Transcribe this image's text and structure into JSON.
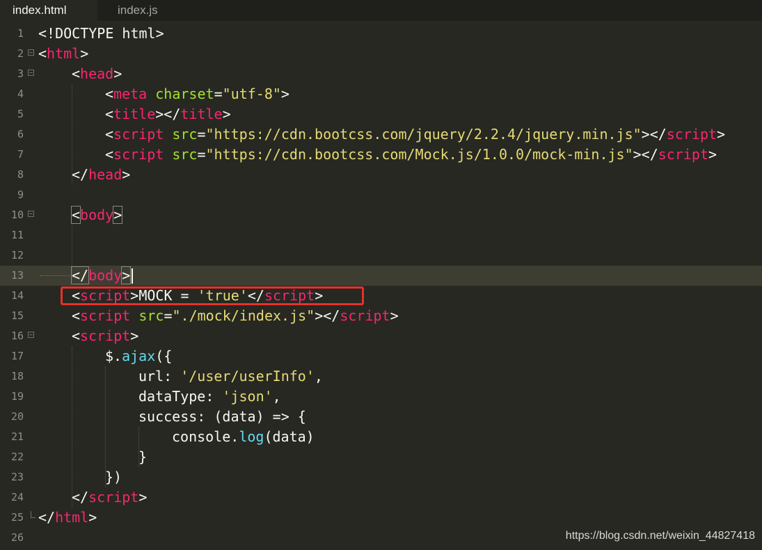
{
  "tabs": [
    {
      "label": "index.html",
      "active": true
    },
    {
      "label": "index.js",
      "active": false
    }
  ],
  "colors": {
    "background": "#272822",
    "tag": "#f92672",
    "attribute": "#a6e22e",
    "string": "#e6db74",
    "function": "#66d9ef",
    "text": "#f8f8f2",
    "annotation": "#e8302a"
  },
  "editor": {
    "current_line": 13,
    "annotated_line": 14,
    "lines": [
      {
        "n": "1",
        "indent": 0,
        "fold": "",
        "tokens": [
          [
            "p",
            "<!DOCTYPE html>"
          ]
        ]
      },
      {
        "n": "2",
        "indent": 0,
        "fold": "open",
        "tokens": [
          [
            "p",
            "<"
          ],
          [
            "tag",
            "html"
          ],
          [
            "p",
            ">"
          ]
        ]
      },
      {
        "n": "3",
        "indent": 1,
        "fold": "open",
        "tokens": [
          [
            "p",
            "<"
          ],
          [
            "tag",
            "head"
          ],
          [
            "p",
            ">"
          ]
        ]
      },
      {
        "n": "4",
        "indent": 2,
        "fold": "",
        "tokens": [
          [
            "p",
            "<"
          ],
          [
            "tag",
            "meta"
          ],
          [
            "p",
            " "
          ],
          [
            "attr",
            "charset"
          ],
          [
            "p",
            "="
          ],
          [
            "str",
            "\"utf-8\""
          ],
          [
            "p",
            ">"
          ]
        ]
      },
      {
        "n": "5",
        "indent": 2,
        "fold": "",
        "tokens": [
          [
            "p",
            "<"
          ],
          [
            "tag",
            "title"
          ],
          [
            "p",
            "></"
          ],
          [
            "tag",
            "title"
          ],
          [
            "p",
            ">"
          ]
        ]
      },
      {
        "n": "6",
        "indent": 2,
        "fold": "",
        "tokens": [
          [
            "p",
            "<"
          ],
          [
            "tag",
            "script"
          ],
          [
            "p",
            " "
          ],
          [
            "attr",
            "src"
          ],
          [
            "p",
            "="
          ],
          [
            "str",
            "\"https://cdn.bootcss.com/jquery/2.2.4/jquery.min.js\""
          ],
          [
            "p",
            "></"
          ],
          [
            "tag",
            "script"
          ],
          [
            "p",
            ">"
          ]
        ]
      },
      {
        "n": "7",
        "indent": 2,
        "fold": "",
        "tokens": [
          [
            "p",
            "<"
          ],
          [
            "tag",
            "script"
          ],
          [
            "p",
            " "
          ],
          [
            "attr",
            "src"
          ],
          [
            "p",
            "="
          ],
          [
            "str",
            "\"https://cdn.bootcss.com/Mock.js/1.0.0/mock-min.js\""
          ],
          [
            "p",
            "></"
          ],
          [
            "tag",
            "script"
          ],
          [
            "p",
            ">"
          ]
        ]
      },
      {
        "n": "8",
        "indent": 1,
        "fold": "",
        "tokens": [
          [
            "p",
            "</"
          ],
          [
            "tag",
            "head"
          ],
          [
            "p",
            ">"
          ]
        ]
      },
      {
        "n": "9",
        "indent": 0,
        "fold": "",
        "tokens": []
      },
      {
        "n": "10",
        "indent": 1,
        "fold": "open",
        "tokens": [
          [
            "box",
            "<"
          ],
          [
            "tag",
            "body"
          ],
          [
            "box",
            ">"
          ]
        ]
      },
      {
        "n": "11",
        "indent": 0,
        "fold": "",
        "tokens": []
      },
      {
        "n": "12",
        "indent": 0,
        "fold": "",
        "tokens": []
      },
      {
        "n": "13",
        "indent": 1,
        "fold": "",
        "tokens": [
          [
            "box",
            "</"
          ],
          [
            "tag",
            "body"
          ],
          [
            "box",
            ">"
          ]
        ]
      },
      {
        "n": "14",
        "indent": 1,
        "fold": "",
        "tokens": [
          [
            "p",
            "<"
          ],
          [
            "tag",
            "script"
          ],
          [
            "p",
            ">MOCK = "
          ],
          [
            "str",
            "'true'"
          ],
          [
            "p",
            "</"
          ],
          [
            "tag",
            "script"
          ],
          [
            "p",
            ">"
          ]
        ]
      },
      {
        "n": "15",
        "indent": 1,
        "fold": "",
        "tokens": [
          [
            "p",
            "<"
          ],
          [
            "tag",
            "script"
          ],
          [
            "p",
            " "
          ],
          [
            "attr",
            "src"
          ],
          [
            "p",
            "="
          ],
          [
            "str",
            "\"./mock/index.js\""
          ],
          [
            "p",
            "></"
          ],
          [
            "tag",
            "script"
          ],
          [
            "p",
            ">"
          ]
        ]
      },
      {
        "n": "16",
        "indent": 1,
        "fold": "open",
        "tokens": [
          [
            "p",
            "<"
          ],
          [
            "tag",
            "script"
          ],
          [
            "p",
            ">"
          ]
        ]
      },
      {
        "n": "17",
        "indent": 2,
        "fold": "",
        "tokens": [
          [
            "p",
            "$."
          ],
          [
            "fn",
            "ajax"
          ],
          [
            "p",
            "({"
          ]
        ]
      },
      {
        "n": "18",
        "indent": 3,
        "fold": "",
        "tokens": [
          [
            "p",
            "url: "
          ],
          [
            "str",
            "'/user/userInfo'"
          ],
          [
            "p",
            ","
          ]
        ]
      },
      {
        "n": "19",
        "indent": 3,
        "fold": "",
        "tokens": [
          [
            "p",
            "dataType: "
          ],
          [
            "str",
            "'json'"
          ],
          [
            "p",
            ","
          ]
        ]
      },
      {
        "n": "20",
        "indent": 3,
        "fold": "",
        "tokens": [
          [
            "p",
            "success: (data) => {"
          ]
        ]
      },
      {
        "n": "21",
        "indent": 4,
        "fold": "",
        "tokens": [
          [
            "p",
            "console."
          ],
          [
            "fn",
            "log"
          ],
          [
            "p",
            "(data)"
          ]
        ]
      },
      {
        "n": "22",
        "indent": 3,
        "fold": "",
        "tokens": [
          [
            "p",
            "}"
          ]
        ]
      },
      {
        "n": "23",
        "indent": 2,
        "fold": "",
        "tokens": [
          [
            "p",
            "})"
          ]
        ]
      },
      {
        "n": "24",
        "indent": 1,
        "fold": "",
        "tokens": [
          [
            "p",
            "</"
          ],
          [
            "tag",
            "script"
          ],
          [
            "p",
            ">"
          ]
        ]
      },
      {
        "n": "25",
        "indent": 0,
        "fold": "end",
        "tokens": [
          [
            "p",
            "</"
          ],
          [
            "tag",
            "html"
          ],
          [
            "p",
            ">"
          ]
        ]
      },
      {
        "n": "26",
        "indent": 0,
        "fold": "",
        "tokens": []
      }
    ]
  },
  "watermark": "https://blog.csdn.net/weixin_44827418"
}
